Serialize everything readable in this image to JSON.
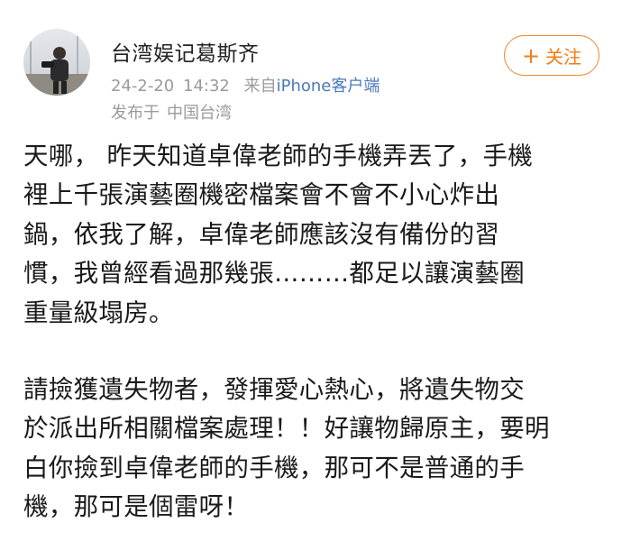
{
  "author": {
    "name": "台湾娱记葛斯齐",
    "date": "24-2-20",
    "time": "14:32",
    "client_prefix": "来自",
    "client": "iPhone客户端",
    "location_prefix": "发布于",
    "location": "中国台湾"
  },
  "follow_button": {
    "plus": "+",
    "label": "关注"
  },
  "paragraphs": [
    {
      "lines": [
        "天哪， 昨天知道卓偉老師的手機弄丟了，手機",
        "裡上千張演藝圈機密檔案會不會不小心炸出",
        "鍋，依我了解，卓偉老師應該沒有備份的習",
        "慣，我曾經看過那幾張………都足以讓演藝圈",
        "重量級塌房。"
      ]
    },
    {
      "lines": [
        "請撿獲遺失物者，發揮愛心熱心，將遺失物交",
        "於派出所相關檔案處理！！好讓物歸原主，要明",
        "白你撿到卓偉老師的手機，那可不是普通的手",
        "機，那可是個雷呀！"
      ]
    }
  ],
  "colors": {
    "accent": "#f07d15",
    "link": "#4a79ba",
    "meta": "#9a9a9a"
  }
}
